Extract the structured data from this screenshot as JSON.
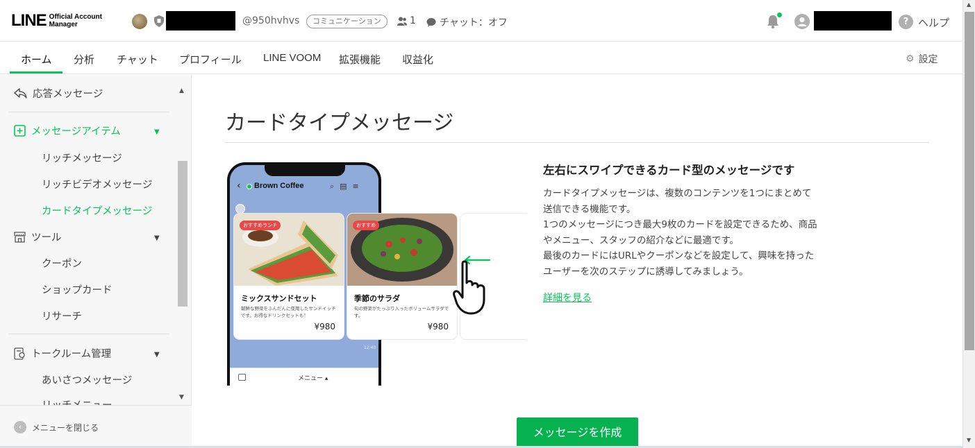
{
  "header": {
    "logo_main": "LINE",
    "logo_sub_1": "Official Account",
    "logo_sub_2": "Manager",
    "account_id": "@950hvhvs",
    "plan_badge": "コミュニケーション",
    "friends_count": "1",
    "chat_status": "チャット：オフ",
    "help_label": "ヘルプ",
    "icons": [
      "account-avatar",
      "shield-icon",
      "person-icon",
      "chat-bubble-icon",
      "bell-icon",
      "user-avatar-icon",
      "help-icon"
    ]
  },
  "nav": {
    "tabs": [
      {
        "label": "ホーム",
        "active": true
      },
      {
        "label": "分析"
      },
      {
        "label": "チャット"
      },
      {
        "label": "プロフィール"
      },
      {
        "label": "LINE VOOM"
      },
      {
        "label": "拡張機能"
      },
      {
        "label": "収益化"
      }
    ],
    "settings_label": "設定"
  },
  "sidebar": {
    "auto_reply": "応答メッセージ",
    "message_items": {
      "label": "メッセージアイテム",
      "children": [
        "リッチメッセージ",
        "リッチビデオメッセージ",
        "カードタイプメッセージ"
      ],
      "active_child": "カードタイプメッセージ"
    },
    "tools": {
      "label": "ツール",
      "children": [
        "クーポン",
        "ショップカード",
        "リサーチ"
      ]
    },
    "talk_room": {
      "label": "トークルーム管理",
      "children": [
        "あいさつメッセージ",
        "リッチメニュー"
      ]
    },
    "close_menu": "メニューを閉じる"
  },
  "main": {
    "title": "カードタイプメッセージ",
    "phone": {
      "chat_name": "Brown Coffee",
      "footer_menu": "メニュー ▴",
      "time": "12:40",
      "cards": [
        {
          "tag": "おすすめランチ",
          "title": "ミックスサンドセット",
          "desc": "朝鮮な野菜をふんだんに使用したサンドイッチです。お得なドリンクセットも！",
          "price": "¥980"
        },
        {
          "tag": "おすすめ",
          "title": "季節のサラダ",
          "desc": "旬の野菜がたっぷり入ったボリュームサラダです。",
          "price": "¥980"
        }
      ]
    },
    "headline": "左右にスワイプできるカード型のメッセージです",
    "body_lines": [
      "カードタイプメッセージは、複数のコンテンツを1つにまとめて",
      "送信できる機能です。",
      "1つのメッセージにつき最大9枚のカードを設定できるため、商品",
      "やメニュー、スタッフの紹介などに最適です。",
      "最後のカードにはURLやクーポンなどを設定して、興味を持った",
      "ユーザーを次のステップに誘導してみましょう。"
    ],
    "details_link": "詳細を見る",
    "create_button": "メッセージを作成"
  },
  "colors": {
    "brand_green": "#06c755",
    "button_green": "#06b250",
    "phone_bg": "#8fabd9",
    "tag_red": "#e84848"
  }
}
